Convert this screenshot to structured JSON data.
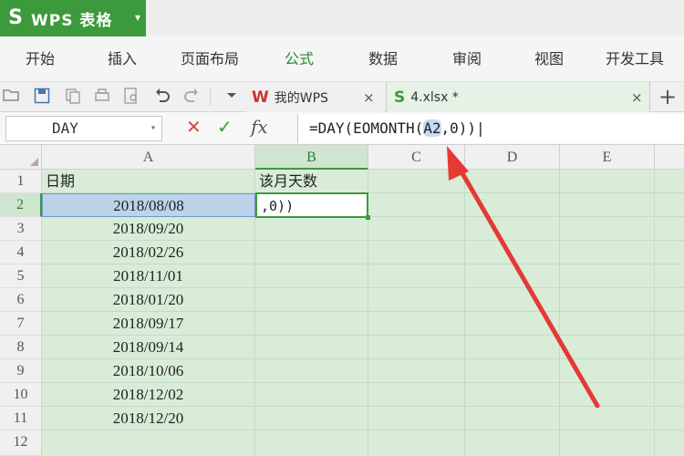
{
  "app": {
    "logo": "S",
    "title": "WPS 表格",
    "dropdown": "▾"
  },
  "ribbon_tabs": [
    "开始",
    "插入",
    "页面布局",
    "公式",
    "数据",
    "审阅",
    "视图",
    "开发工具"
  ],
  "ribbon_active": "公式",
  "toolbar": {
    "icons": [
      "open-icon",
      "save-icon",
      "copy-icon",
      "print-icon",
      "preview-icon",
      "undo-icon",
      "redo-icon",
      "more-icon"
    ]
  },
  "doc_tabs": [
    {
      "logo": "W",
      "label": "我的WPS",
      "close": "×"
    },
    {
      "logo": "S",
      "label": "4.xlsx *",
      "close": "×"
    }
  ],
  "new_tab": "+",
  "formula_bar": {
    "name_box": "DAY",
    "cancel": "✕",
    "accept": "✓",
    "fx": "fx",
    "formula_prefix": "=DAY(EOMONTH(",
    "formula_ref": "A2",
    "formula_suffix": ",0))",
    "cursor": "|"
  },
  "columns": [
    "A",
    "B",
    "C",
    "D",
    "E"
  ],
  "selected_column": "B",
  "rows": [
    "1",
    "2",
    "3",
    "4",
    "5",
    "6",
    "7",
    "8",
    "9",
    "10",
    "11",
    "12"
  ],
  "selected_row": "2",
  "sheet": {
    "a1": "日期",
    "b1": "该月天数",
    "b2_editing": ",0))",
    "dates": [
      "2018/08/08",
      "2018/09/20",
      "2018/02/26",
      "2018/11/01",
      "2018/01/20",
      "2018/09/17",
      "2018/09/14",
      "2018/10/06",
      "2018/12/02",
      "2018/12/20"
    ]
  },
  "colors": {
    "accent": "#3c9a3c",
    "annotation_arrow": "#e53935",
    "sheet_bg": "#d8ecd8"
  }
}
